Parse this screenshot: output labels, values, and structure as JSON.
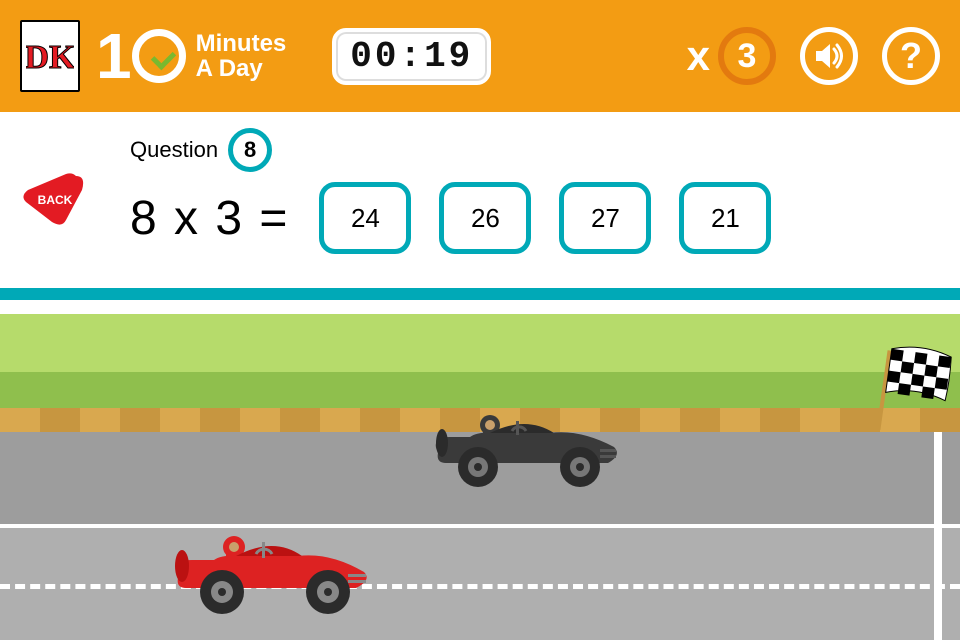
{
  "header": {
    "brand_line1": "Minutes",
    "brand_line2": "A Day",
    "timer": "00:19",
    "multiplier_symbol": "x",
    "multiplier_value": "3"
  },
  "back_label": "BACK",
  "question": {
    "label": "Question",
    "number": "8",
    "equation": "8 x 3 =",
    "answers": [
      "24",
      "26",
      "27",
      "21"
    ]
  },
  "icons": {
    "sound": "speaker-icon",
    "help": "?"
  }
}
